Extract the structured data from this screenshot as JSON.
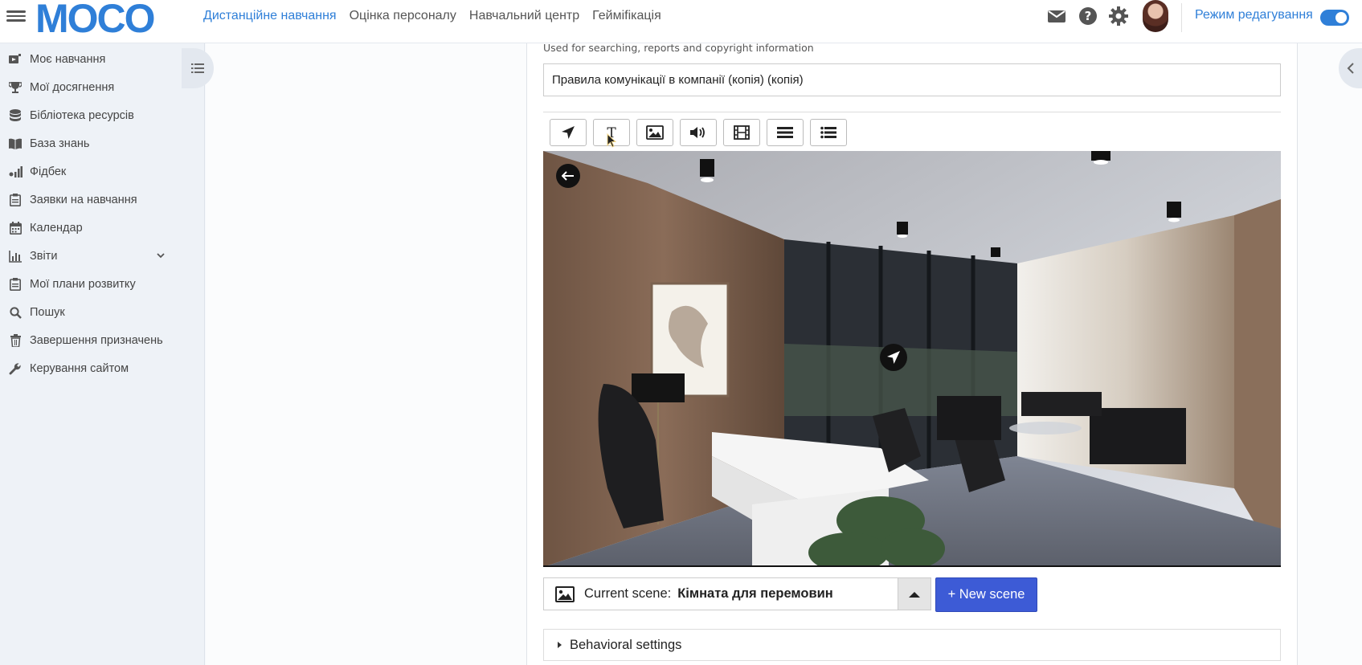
{
  "header": {
    "logo": "MOCO",
    "nav": [
      {
        "label": "Дистанційне навчання",
        "active": true
      },
      {
        "label": "Оцінка персоналу",
        "active": false
      },
      {
        "label": "Навчальний центр",
        "active": false
      },
      {
        "label": "Геймifікація",
        "active": false
      }
    ],
    "edit_mode_label": "Режим редагування",
    "icons": [
      "hamburger-icon",
      "mail-icon",
      "help-icon",
      "gear-icon",
      "avatar"
    ]
  },
  "sidebar": {
    "items": [
      {
        "label": "Моє навчання",
        "icon": "video-icon"
      },
      {
        "label": "Мої досягнення",
        "icon": "trophy-icon"
      },
      {
        "label": "Бібліотека ресурсів",
        "icon": "database-icon"
      },
      {
        "label": "База знань",
        "icon": "book-icon"
      },
      {
        "label": "Фідбек",
        "icon": "feedback-icon"
      },
      {
        "label": "Заявки на навчання",
        "icon": "clipboard-icon"
      },
      {
        "label": "Календар",
        "icon": "calendar-icon"
      },
      {
        "label": "Звіти",
        "icon": "chart-icon"
      },
      {
        "label": "Мої плани розвитку",
        "icon": "clipboard-icon"
      },
      {
        "label": "Пошук",
        "icon": "search-icon"
      },
      {
        "label": "Завершення призначень",
        "icon": "trash-icon"
      },
      {
        "label": "Керування сайтом",
        "icon": "wrench-icon"
      }
    ]
  },
  "editor": {
    "help_text": "Used for searching, reports and copyright information",
    "title_value": "Правила комунікації в компанії (копія) (копія)",
    "toolbar": [
      "navigate-icon",
      "text-icon",
      "image-icon",
      "audio-icon",
      "video-icon",
      "list-icon",
      "numbered-list-icon"
    ],
    "current_scene_label": "Current scene:",
    "current_scene_name": "Кімната для перемовин",
    "new_scene_label": "+ New scene",
    "behavioral_settings_label": "Behavioral settings"
  },
  "colors": {
    "accent": "#2f7fd8",
    "button": "#3d5bd6"
  }
}
